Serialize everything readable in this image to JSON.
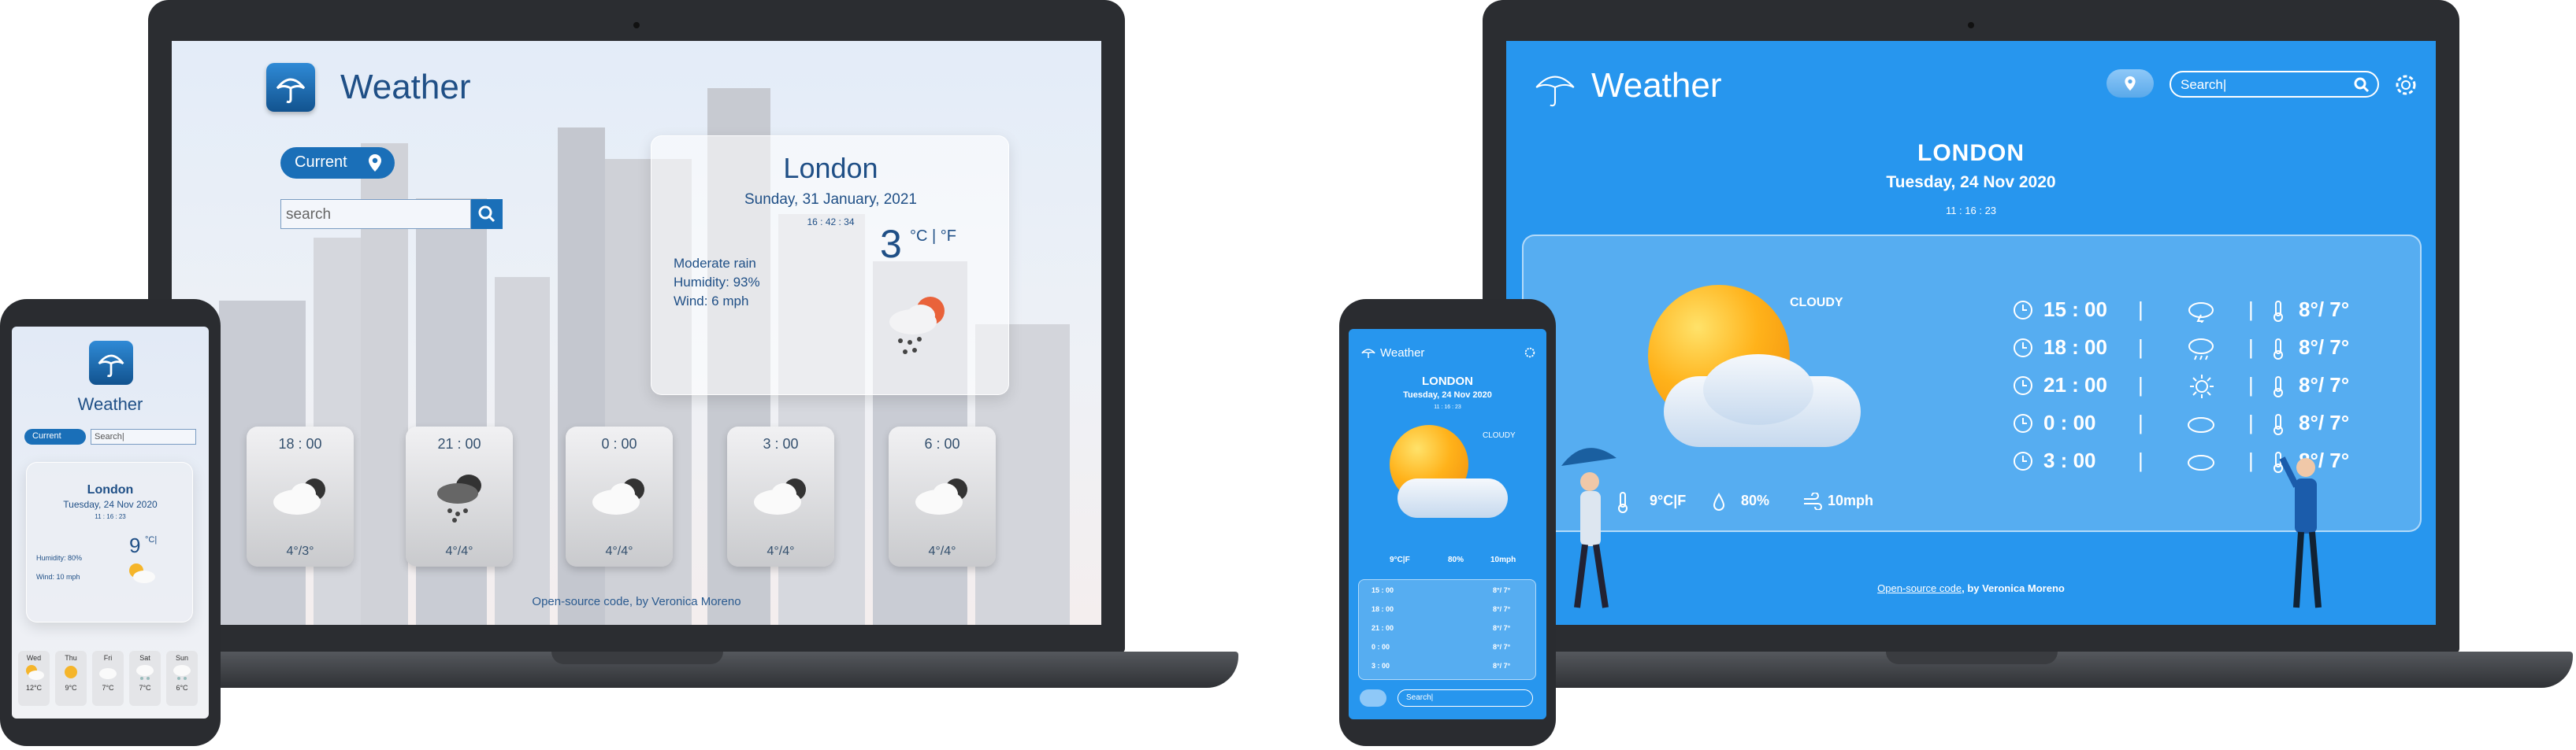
{
  "laptop_light": {
    "app_title": "Weather",
    "current_button": "Current",
    "search_placeholder": "search",
    "card": {
      "city": "London",
      "date": "Sunday, 31 January, 2021",
      "time": "16 : 42 : 34",
      "temp": "3",
      "units": "°C | °F",
      "condition": "Moderate rain",
      "humidity": "Humidity: 93%",
      "wind": "Wind: 6 mph"
    },
    "forecast": [
      {
        "time": "18 : 00",
        "temp": "4°/3°",
        "icon": "cloudy-icon"
      },
      {
        "time": "21 : 00",
        "temp": "4°/4°",
        "icon": "rain-icon"
      },
      {
        "time": "0 : 00",
        "temp": "4°/4°",
        "icon": "cloudy-icon"
      },
      {
        "time": "3 : 00",
        "temp": "4°/4°",
        "icon": "cloudy-icon"
      },
      {
        "time": "6 : 00",
        "temp": "4°/4°",
        "icon": "cloudy-icon"
      }
    ],
    "footer_link": "Open-source code",
    "footer_rest": ", by Veronica Moreno"
  },
  "phone_light": {
    "app_title": "Weather",
    "current_button": "Current",
    "search_placeholder": "Search|",
    "city": "London",
    "date": "Tuesday, 24 Nov 2020",
    "time": "11 : 16 : 23",
    "temp": "9",
    "units": "°C|",
    "humidity": "Humidity: 80%",
    "wind": "Wind: 10 mph",
    "days": [
      {
        "day": "Wed",
        "temp": "12°C",
        "icon": "partly-sunny-icon"
      },
      {
        "day": "Thu",
        "temp": "9°C",
        "icon": "sun-icon"
      },
      {
        "day": "Fri",
        "temp": "7°C",
        "icon": "cloud-icon"
      },
      {
        "day": "Sat",
        "temp": "7°C",
        "icon": "snow-icon"
      },
      {
        "day": "Sun",
        "temp": "6°C",
        "icon": "snow-icon"
      }
    ]
  },
  "laptop_blue": {
    "app_title": "Weather",
    "search_placeholder": "Search|",
    "city": "LONDON",
    "date": "Tuesday, 24 Nov 2020",
    "time": "11 : 16 : 23",
    "condition": "CLOUDY",
    "temp": "9°C|F",
    "humidity": "80%",
    "wind": "10mph",
    "hours": [
      {
        "time": "15 : 00",
        "icon": "storm-cloud-icon",
        "temp": "8°/ 7°"
      },
      {
        "time": "18 : 00",
        "icon": "rain-cloud-icon",
        "temp": "8°/ 7°"
      },
      {
        "time": "21 : 00",
        "icon": "sun-icon",
        "temp": "8°/ 7°"
      },
      {
        "time": "0 : 00",
        "icon": "cloud-icon",
        "temp": "8°/ 7°"
      },
      {
        "time": "3 : 00",
        "icon": "cloud-icon",
        "temp": "8°/ 7°"
      }
    ],
    "footer_link": "Open-source code",
    "footer_rest": ", by Veronica Moreno"
  },
  "phone_blue": {
    "app_title": "Weather",
    "city": "LONDON",
    "date": "Tuesday, 24 Nov 2020",
    "time": "11 : 16 : 23",
    "condition": "CLOUDY",
    "temp": "9°C|F",
    "humidity": "80%",
    "wind": "10mph",
    "hours": [
      {
        "time": "15 : 00",
        "temp": "8°/ 7°"
      },
      {
        "time": "18 : 00",
        "temp": "8°/ 7°"
      },
      {
        "time": "21 : 00",
        "temp": "8°/ 7°"
      },
      {
        "time": "0 : 00",
        "temp": "8°/ 7°"
      },
      {
        "time": "3 : 00",
        "temp": "8°/ 7°"
      }
    ],
    "search_placeholder": "Search|"
  },
  "colors": {
    "light_accent": "#1a6fb8",
    "blue_background": "#2796ee",
    "sun": "#ffb21a"
  }
}
